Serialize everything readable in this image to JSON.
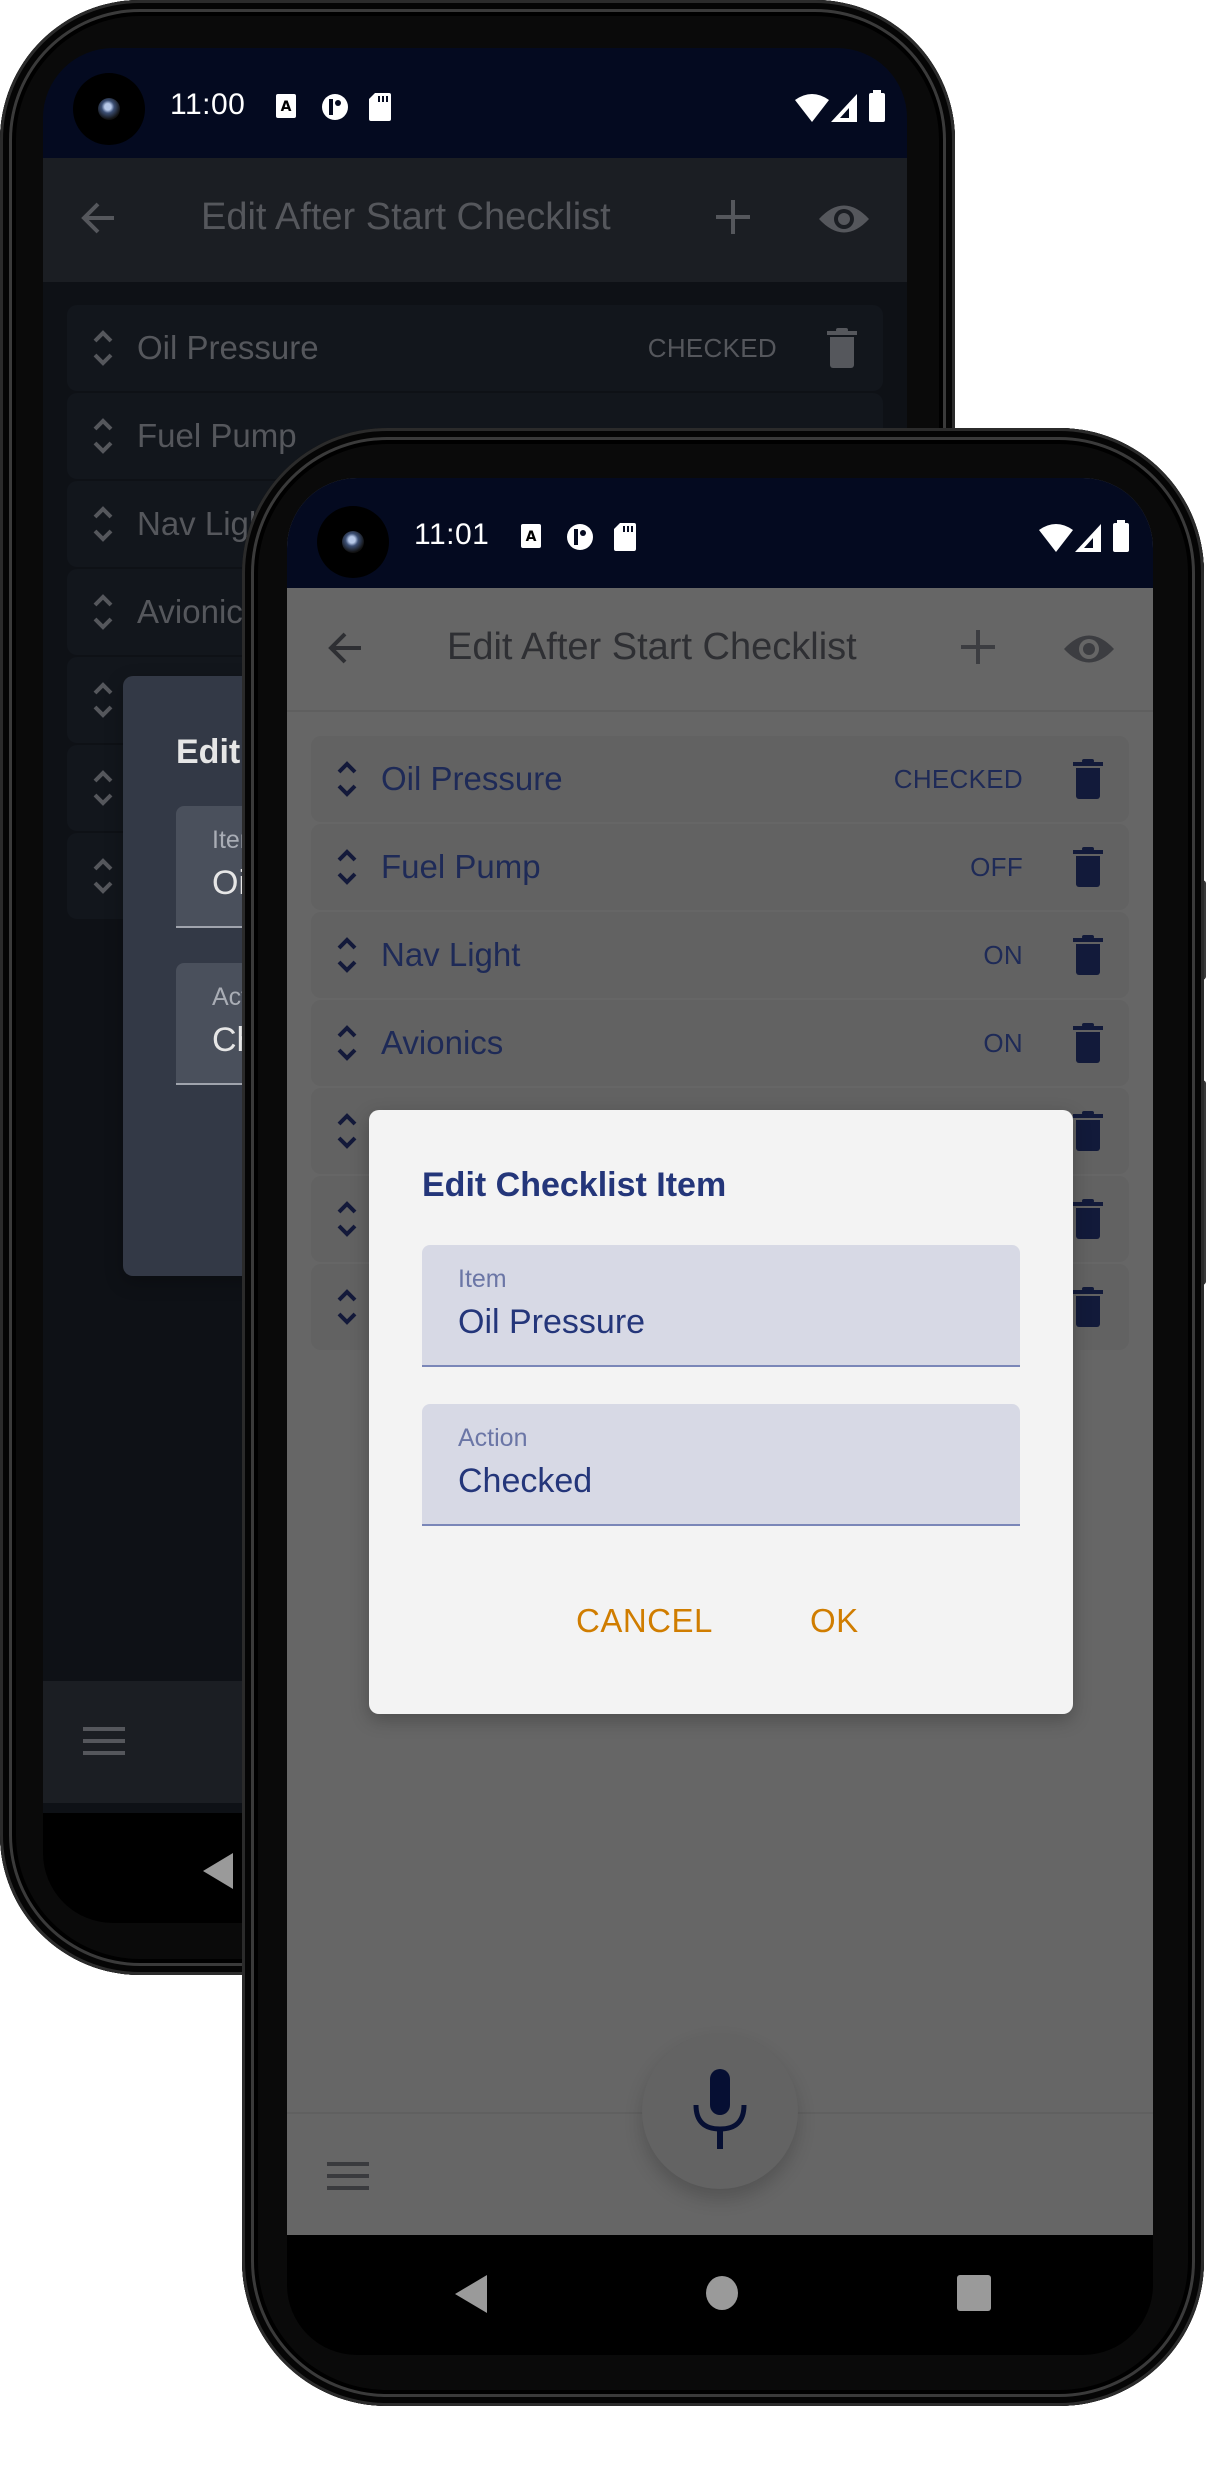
{
  "back_phone": {
    "status_bar": {
      "time": "11:00",
      "left_icons": [
        "accessibility-icon",
        "pocket-casts-icon",
        "sd-card-icon"
      ],
      "right_icons": [
        "wifi-icon",
        "signal-icon",
        "battery-icon"
      ]
    },
    "app_bar": {
      "title": "Edit After Start Checklist",
      "back_icon": "arrow-back-icon",
      "add_icon": "plus-icon",
      "preview_icon": "eye-icon"
    },
    "items": [
      {
        "name": "Oil Pressure",
        "action": "CHECKED"
      },
      {
        "name": "Fuel Pump",
        "action": ""
      },
      {
        "name": "Nav Light",
        "action": ""
      },
      {
        "name": "Avionics",
        "action": ""
      },
      {
        "name": "",
        "action": ""
      },
      {
        "name": "",
        "action": ""
      },
      {
        "name": "",
        "action": ""
      }
    ],
    "dialog": {
      "title": "Edit Checklist Item",
      "item_label": "Item",
      "item_value": "Oil Pressure",
      "action_label": "Action",
      "action_value": "Checked"
    },
    "theme": "dark"
  },
  "front_phone": {
    "status_bar": {
      "time": "11:01",
      "left_icons": [
        "accessibility-icon",
        "pocket-casts-icon",
        "sd-card-icon"
      ],
      "right_icons": [
        "wifi-icon",
        "signal-icon",
        "battery-icon"
      ]
    },
    "app_bar": {
      "title": "Edit After Start Checklist",
      "back_icon": "arrow-back-icon",
      "add_icon": "plus-icon",
      "preview_icon": "eye-icon"
    },
    "items": [
      {
        "name": "Oil Pressure",
        "action": "CHECKED"
      },
      {
        "name": "Fuel Pump",
        "action": "OFF"
      },
      {
        "name": "Nav Light",
        "action": "ON"
      },
      {
        "name": "Avionics",
        "action": "ON"
      },
      {
        "name": "",
        "action": ""
      },
      {
        "name": "",
        "action": ""
      },
      {
        "name": "",
        "action": ""
      }
    ],
    "dialog": {
      "title": "Edit Checklist Item",
      "item_label": "Item",
      "item_value": "Oil Pressure",
      "action_label": "Action",
      "action_value": "Checked",
      "cancel_label": "CANCEL",
      "ok_label": "OK"
    },
    "bottom_bar": {
      "menu_icon": "hamburger-menu-icon",
      "fab_icon": "microphone-icon"
    },
    "theme": "light"
  },
  "system_nav": {
    "back": "nav-back-icon",
    "home": "nav-home-icon",
    "recents": "nav-recents-icon"
  },
  "colors": {
    "status_bar": "#040a20",
    "primary_text": "#1e2f6e",
    "dialog_bg": "#f3f3f3",
    "field_bg": "#d7d9e5",
    "accent_button": "#d07d00",
    "scrim_light": "#666666",
    "dark_screen": "#0e1116"
  }
}
